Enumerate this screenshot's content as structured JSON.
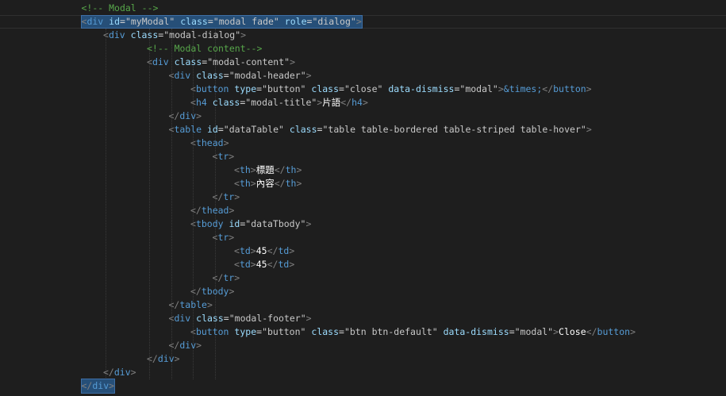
{
  "editor": {
    "theme_colors": {
      "background": "#1e1e1e",
      "selection": "#264f78",
      "tag": "#569cd6",
      "attribute": "#9cdcfe",
      "comment": "#57a64a",
      "punctuation": "#808080"
    },
    "lines": [
      {
        "indent": 3,
        "tokens": [
          [
            "c-comment",
            "<!-- Modal -->"
          ]
        ]
      },
      {
        "indent": 3,
        "current": true,
        "selected": true,
        "tokens": [
          [
            "c-punct",
            "<"
          ],
          [
            "c-tag",
            "div"
          ],
          [
            "c-text",
            " "
          ],
          [
            "c-attr",
            "id"
          ],
          [
            "c-eq",
            "="
          ],
          [
            "c-str",
            "\"myModal\""
          ],
          [
            "c-text",
            " "
          ],
          [
            "c-attr",
            "class"
          ],
          [
            "c-eq",
            "="
          ],
          [
            "c-str",
            "\"modal fade\""
          ],
          [
            "c-text",
            " "
          ],
          [
            "c-attr",
            "role"
          ],
          [
            "c-eq",
            "="
          ],
          [
            "c-str",
            "\"dialog\""
          ],
          [
            "c-punct",
            ">"
          ]
        ]
      },
      {
        "indent": 4,
        "tokens": [
          [
            "c-punct",
            "<"
          ],
          [
            "c-tag",
            "div"
          ],
          [
            "c-text",
            " "
          ],
          [
            "c-attr",
            "class"
          ],
          [
            "c-eq",
            "="
          ],
          [
            "c-str",
            "\"modal-dialog\""
          ],
          [
            "c-punct",
            ">"
          ]
        ]
      },
      {
        "indent": 6,
        "tokens": [
          [
            "c-comment",
            "<!-- Modal content-->"
          ]
        ]
      },
      {
        "indent": 6,
        "tokens": [
          [
            "c-punct",
            "<"
          ],
          [
            "c-tag",
            "div"
          ],
          [
            "c-text",
            " "
          ],
          [
            "c-attr",
            "class"
          ],
          [
            "c-eq",
            "="
          ],
          [
            "c-str",
            "\"modal-content\""
          ],
          [
            "c-punct",
            ">"
          ]
        ]
      },
      {
        "indent": 7,
        "tokens": [
          [
            "c-punct",
            "<"
          ],
          [
            "c-tag",
            "div"
          ],
          [
            "c-text",
            " "
          ],
          [
            "c-attr",
            "class"
          ],
          [
            "c-eq",
            "="
          ],
          [
            "c-str",
            "\"modal-header\""
          ],
          [
            "c-punct",
            ">"
          ]
        ]
      },
      {
        "indent": 8,
        "tokens": [
          [
            "c-punct",
            "<"
          ],
          [
            "c-tag",
            "button"
          ],
          [
            "c-text",
            " "
          ],
          [
            "c-attr",
            "type"
          ],
          [
            "c-eq",
            "="
          ],
          [
            "c-str",
            "\"button\""
          ],
          [
            "c-text",
            " "
          ],
          [
            "c-attr",
            "class"
          ],
          [
            "c-eq",
            "="
          ],
          [
            "c-str",
            "\"close\""
          ],
          [
            "c-text",
            " "
          ],
          [
            "c-attr",
            "data-dismiss"
          ],
          [
            "c-eq",
            "="
          ],
          [
            "c-str",
            "\"modal\""
          ],
          [
            "c-punct",
            ">"
          ],
          [
            "c-ent",
            "&times;"
          ],
          [
            "c-punct",
            "</"
          ],
          [
            "c-tag",
            "button"
          ],
          [
            "c-punct",
            ">"
          ]
        ]
      },
      {
        "indent": 8,
        "tokens": [
          [
            "c-punct",
            "<"
          ],
          [
            "c-tag",
            "h4"
          ],
          [
            "c-text",
            " "
          ],
          [
            "c-attr",
            "class"
          ],
          [
            "c-eq",
            "="
          ],
          [
            "c-str",
            "\"modal-title\""
          ],
          [
            "c-punct",
            ">"
          ],
          [
            "c-text",
            "片語"
          ],
          [
            "c-punct",
            "</"
          ],
          [
            "c-tag",
            "h4"
          ],
          [
            "c-punct",
            ">"
          ]
        ]
      },
      {
        "indent": 7,
        "tokens": [
          [
            "c-punct",
            "</"
          ],
          [
            "c-tag",
            "div"
          ],
          [
            "c-punct",
            ">"
          ]
        ]
      },
      {
        "indent": 7,
        "tokens": [
          [
            "c-punct",
            "<"
          ],
          [
            "c-tag",
            "table"
          ],
          [
            "c-text",
            " "
          ],
          [
            "c-attr",
            "id"
          ],
          [
            "c-eq",
            "="
          ],
          [
            "c-str",
            "\"dataTable\""
          ],
          [
            "c-text",
            " "
          ],
          [
            "c-attr",
            "class"
          ],
          [
            "c-eq",
            "="
          ],
          [
            "c-str",
            "\"table table-bordered table-striped table-hover\""
          ],
          [
            "c-punct",
            ">"
          ]
        ]
      },
      {
        "indent": 8,
        "tokens": [
          [
            "c-punct",
            "<"
          ],
          [
            "c-tag",
            "thead"
          ],
          [
            "c-punct",
            ">"
          ]
        ]
      },
      {
        "indent": 9,
        "tokens": [
          [
            "c-punct",
            "<"
          ],
          [
            "c-tag",
            "tr"
          ],
          [
            "c-punct",
            ">"
          ]
        ]
      },
      {
        "indent": 10,
        "tokens": [
          [
            "c-punct",
            "<"
          ],
          [
            "c-tag",
            "th"
          ],
          [
            "c-punct",
            ">"
          ],
          [
            "c-text",
            "標題"
          ],
          [
            "c-punct",
            "</"
          ],
          [
            "c-tag",
            "th"
          ],
          [
            "c-punct",
            ">"
          ]
        ]
      },
      {
        "indent": 10,
        "tokens": [
          [
            "c-punct",
            "<"
          ],
          [
            "c-tag",
            "th"
          ],
          [
            "c-punct",
            ">"
          ],
          [
            "c-text",
            "內容"
          ],
          [
            "c-punct",
            "</"
          ],
          [
            "c-tag",
            "th"
          ],
          [
            "c-punct",
            ">"
          ]
        ]
      },
      {
        "indent": 9,
        "tokens": [
          [
            "c-punct",
            "</"
          ],
          [
            "c-tag",
            "tr"
          ],
          [
            "c-punct",
            ">"
          ]
        ]
      },
      {
        "indent": 8,
        "tokens": [
          [
            "c-punct",
            "</"
          ],
          [
            "c-tag",
            "thead"
          ],
          [
            "c-punct",
            ">"
          ]
        ]
      },
      {
        "indent": 8,
        "tokens": [
          [
            "c-punct",
            "<"
          ],
          [
            "c-tag",
            "tbody"
          ],
          [
            "c-text",
            " "
          ],
          [
            "c-attr",
            "id"
          ],
          [
            "c-eq",
            "="
          ],
          [
            "c-str",
            "\"dataTbody\""
          ],
          [
            "c-punct",
            ">"
          ]
        ]
      },
      {
        "indent": 9,
        "tokens": [
          [
            "c-punct",
            "<"
          ],
          [
            "c-tag",
            "tr"
          ],
          [
            "c-punct",
            ">"
          ]
        ]
      },
      {
        "indent": 10,
        "tokens": [
          [
            "c-punct",
            "<"
          ],
          [
            "c-tag",
            "td"
          ],
          [
            "c-punct",
            ">"
          ],
          [
            "c-text",
            "45"
          ],
          [
            "c-punct",
            "</"
          ],
          [
            "c-tag",
            "td"
          ],
          [
            "c-punct",
            ">"
          ]
        ]
      },
      {
        "indent": 10,
        "tokens": [
          [
            "c-punct",
            "<"
          ],
          [
            "c-tag",
            "td"
          ],
          [
            "c-punct",
            ">"
          ],
          [
            "c-text",
            "45"
          ],
          [
            "c-punct",
            "</"
          ],
          [
            "c-tag",
            "td"
          ],
          [
            "c-punct",
            ">"
          ]
        ]
      },
      {
        "indent": 9,
        "tokens": [
          [
            "c-punct",
            "</"
          ],
          [
            "c-tag",
            "tr"
          ],
          [
            "c-punct",
            ">"
          ]
        ]
      },
      {
        "indent": 8,
        "tokens": [
          [
            "c-punct",
            "</"
          ],
          [
            "c-tag",
            "tbody"
          ],
          [
            "c-punct",
            ">"
          ]
        ]
      },
      {
        "indent": 7,
        "tokens": [
          [
            "c-punct",
            "</"
          ],
          [
            "c-tag",
            "table"
          ],
          [
            "c-punct",
            ">"
          ]
        ]
      },
      {
        "indent": 7,
        "tokens": [
          [
            "c-punct",
            "<"
          ],
          [
            "c-tag",
            "div"
          ],
          [
            "c-text",
            " "
          ],
          [
            "c-attr",
            "class"
          ],
          [
            "c-eq",
            "="
          ],
          [
            "c-str",
            "\"modal-footer\""
          ],
          [
            "c-punct",
            ">"
          ]
        ]
      },
      {
        "indent": 8,
        "tokens": [
          [
            "c-punct",
            "<"
          ],
          [
            "c-tag",
            "button"
          ],
          [
            "c-text",
            " "
          ],
          [
            "c-attr",
            "type"
          ],
          [
            "c-eq",
            "="
          ],
          [
            "c-str",
            "\"button\""
          ],
          [
            "c-text",
            " "
          ],
          [
            "c-attr",
            "class"
          ],
          [
            "c-eq",
            "="
          ],
          [
            "c-str",
            "\"btn btn-default\""
          ],
          [
            "c-text",
            " "
          ],
          [
            "c-attr",
            "data-dismiss"
          ],
          [
            "c-eq",
            "="
          ],
          [
            "c-str",
            "\"modal\""
          ],
          [
            "c-punct",
            ">"
          ],
          [
            "c-text",
            "Close"
          ],
          [
            "c-punct",
            "</"
          ],
          [
            "c-tag",
            "button"
          ],
          [
            "c-punct",
            ">"
          ]
        ]
      },
      {
        "indent": 7,
        "tokens": [
          [
            "c-punct",
            "</"
          ],
          [
            "c-tag",
            "div"
          ],
          [
            "c-punct",
            ">"
          ]
        ]
      },
      {
        "indent": 6,
        "tokens": [
          [
            "c-punct",
            "</"
          ],
          [
            "c-tag",
            "div"
          ],
          [
            "c-punct",
            ">"
          ]
        ]
      },
      {
        "indent": 4,
        "tokens": [
          [
            "c-punct",
            "</"
          ],
          [
            "c-tag",
            "div"
          ],
          [
            "c-punct",
            ">"
          ]
        ]
      },
      {
        "indent": 3,
        "selected": true,
        "tokens": [
          [
            "c-punct",
            "</"
          ],
          [
            "c-tag",
            "div"
          ],
          [
            "c-punct",
            ">"
          ]
        ]
      }
    ]
  }
}
